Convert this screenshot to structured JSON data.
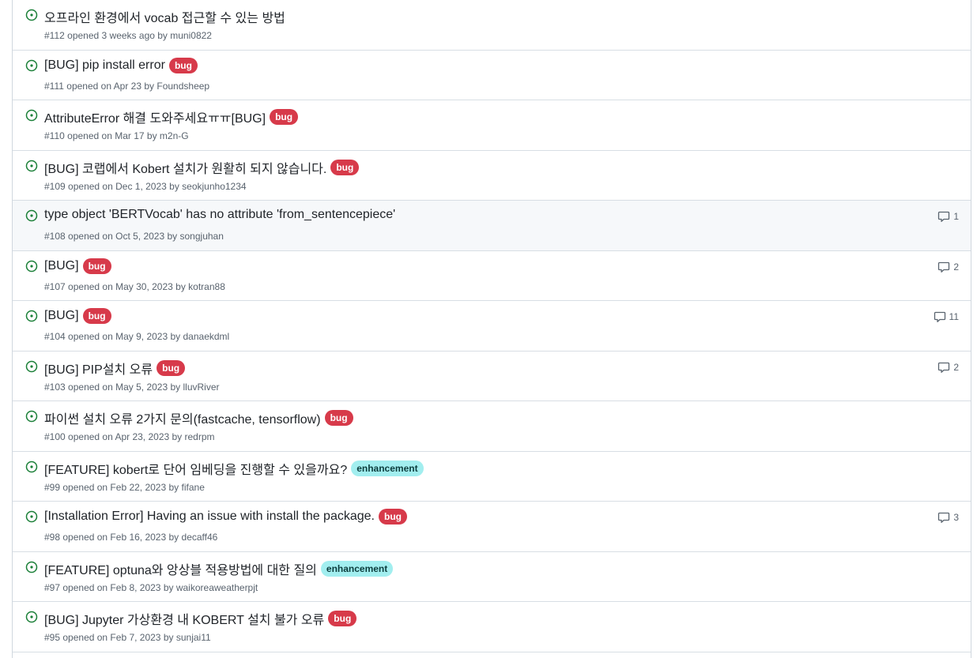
{
  "issues": [
    {
      "title": "오프라인 환경에서 vocab 접근할 수 있는 방법",
      "label": "",
      "label_type": "",
      "number": "#112",
      "opened": "opened 3 weeks ago by",
      "author": "muni0822",
      "comments": ""
    },
    {
      "title": "[BUG] pip install error",
      "label": "bug",
      "label_type": "bug",
      "number": "#111",
      "opened": "opened on Apr 23 by",
      "author": "Foundsheep",
      "comments": ""
    },
    {
      "title": "AttributeError 해결 도와주세요ㅠㅠ[BUG]",
      "label": "bug",
      "label_type": "bug",
      "number": "#110",
      "opened": "opened on Mar 17 by",
      "author": "m2n-G",
      "comments": ""
    },
    {
      "title": "[BUG] 코랩에서 Kobert 설치가 원활히 되지 않습니다.",
      "label": "bug",
      "label_type": "bug",
      "number": "#109",
      "opened": "opened on Dec 1, 2023 by",
      "author": "seokjunho1234",
      "comments": ""
    },
    {
      "title": "type object 'BERTVocab' has no attribute 'from_sentencepiece'",
      "label": "",
      "label_type": "",
      "number": "#108",
      "opened": "opened on Oct 5, 2023 by",
      "author": "songjuhan",
      "comments": "1"
    },
    {
      "title": "[BUG]",
      "label": "bug",
      "label_type": "bug",
      "number": "#107",
      "opened": "opened on May 30, 2023 by",
      "author": "kotran88",
      "comments": "2"
    },
    {
      "title": "[BUG]",
      "label": "bug",
      "label_type": "bug",
      "number": "#104",
      "opened": "opened on May 9, 2023 by",
      "author": "danaekdml",
      "comments": "11"
    },
    {
      "title": "[BUG] PIP설치 오류",
      "label": "bug",
      "label_type": "bug",
      "number": "#103",
      "opened": "opened on May 5, 2023 by",
      "author": "lluvRiver",
      "comments": "2"
    },
    {
      "title": "파이썬 설치 오류 2가지 문의(fastcache, tensorflow)",
      "label": "bug",
      "label_type": "bug",
      "number": "#100",
      "opened": "opened on Apr 23, 2023 by",
      "author": "redrpm",
      "comments": ""
    },
    {
      "title": "[FEATURE] kobert로 단어 임베딩을 진행할 수 있을까요?",
      "label": "enhancement",
      "label_type": "enh",
      "number": "#99",
      "opened": "opened on Feb 22, 2023 by",
      "author": "fifane",
      "comments": ""
    },
    {
      "title": "[Installation Error] Having an issue with install the package.",
      "label": "bug",
      "label_type": "bug",
      "number": "#98",
      "opened": "opened on Feb 16, 2023 by",
      "author": "decaff46",
      "comments": "3"
    },
    {
      "title": "[FEATURE] optuna와 앙상블 적용방법에 대한 질의",
      "label": "enhancement",
      "label_type": "enh",
      "number": "#97",
      "opened": "opened on Feb 8, 2023 by",
      "author": "waikoreaweatherpjt",
      "comments": ""
    },
    {
      "title": "[BUG] Jupyter 가상환경 내 KOBERT 설치 불가 오류",
      "label": "bug",
      "label_type": "bug",
      "number": "#95",
      "opened": "opened on Feb 7, 2023 by",
      "author": "sunjai11",
      "comments": ""
    }
  ],
  "colors": {
    "open_icon": "#1a7f37",
    "bug_label": "#d73a4a",
    "enhancement_label": "#a2eeef",
    "muted_text": "#59636e"
  },
  "icons": {
    "issue_state": "issue-opened-icon",
    "comments": "comment-icon"
  },
  "highlighted_row": 4
}
